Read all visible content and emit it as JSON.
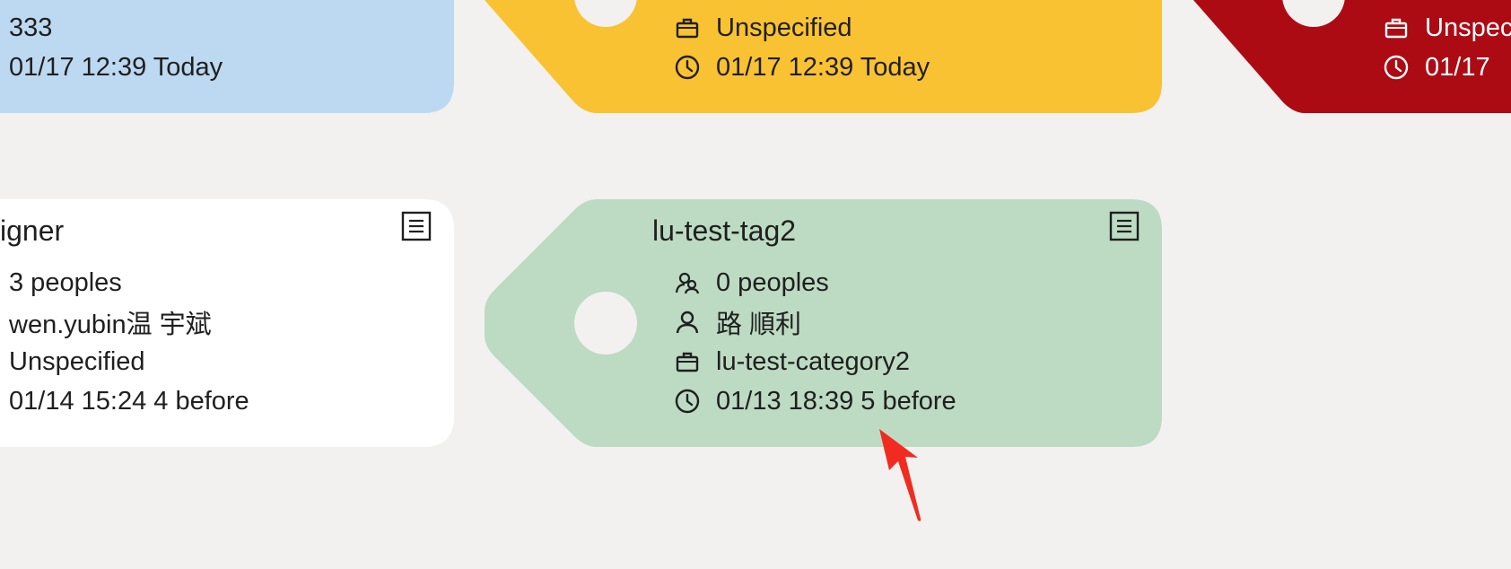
{
  "cards": {
    "blue": {
      "color": "#bcd9f1",
      "rows": {
        "count": "333",
        "date": "01/17 12:39 Today"
      }
    },
    "yellow": {
      "color": "#f9c233",
      "rows": {
        "category": "Unspecified",
        "date": "01/17 12:39 Today"
      }
    },
    "red": {
      "color": "#ad0b14",
      "rows": {
        "category": "Unspec",
        "date": "01/17"
      }
    },
    "white": {
      "color": "#ffffff",
      "title": "igner",
      "rows": {
        "members": "3 peoples",
        "owner": "wen.yubin温 宇斌",
        "category": "Unspecified",
        "date": "01/14 15:24 4 before"
      }
    },
    "green": {
      "color": "#bcdbc2",
      "title": "lu-test-tag2",
      "rows": {
        "members": "0 peoples",
        "owner": "路 順利",
        "category": "lu-test-category2",
        "date": "01/13 18:39 5 before"
      }
    }
  },
  "icons": {
    "members": "people-icon",
    "owner": "person-icon",
    "category": "briefcase-icon",
    "date": "clock-icon",
    "memo": "memo-icon"
  },
  "annotation": {
    "arrow_color": "#f22b20"
  }
}
